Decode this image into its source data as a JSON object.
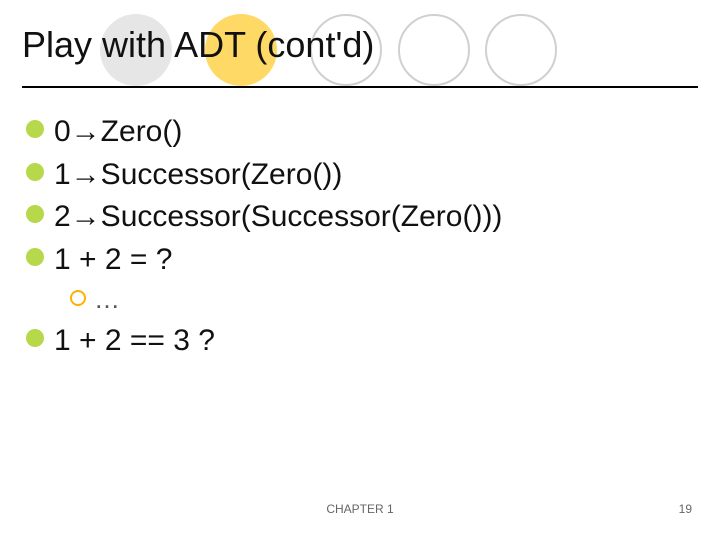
{
  "title": "Play with ADT (cont'd)",
  "bullets": {
    "b0": "0→Zero()",
    "b1": "1→Successor(Zero())",
    "b2": "2→Successor(Successor(Zero()))",
    "b3": "1 + 2 = ?",
    "sub0": "…",
    "b4": "1 + 2 == 3 ?"
  },
  "footer": {
    "center": "CHAPTER 1",
    "page": "19"
  }
}
